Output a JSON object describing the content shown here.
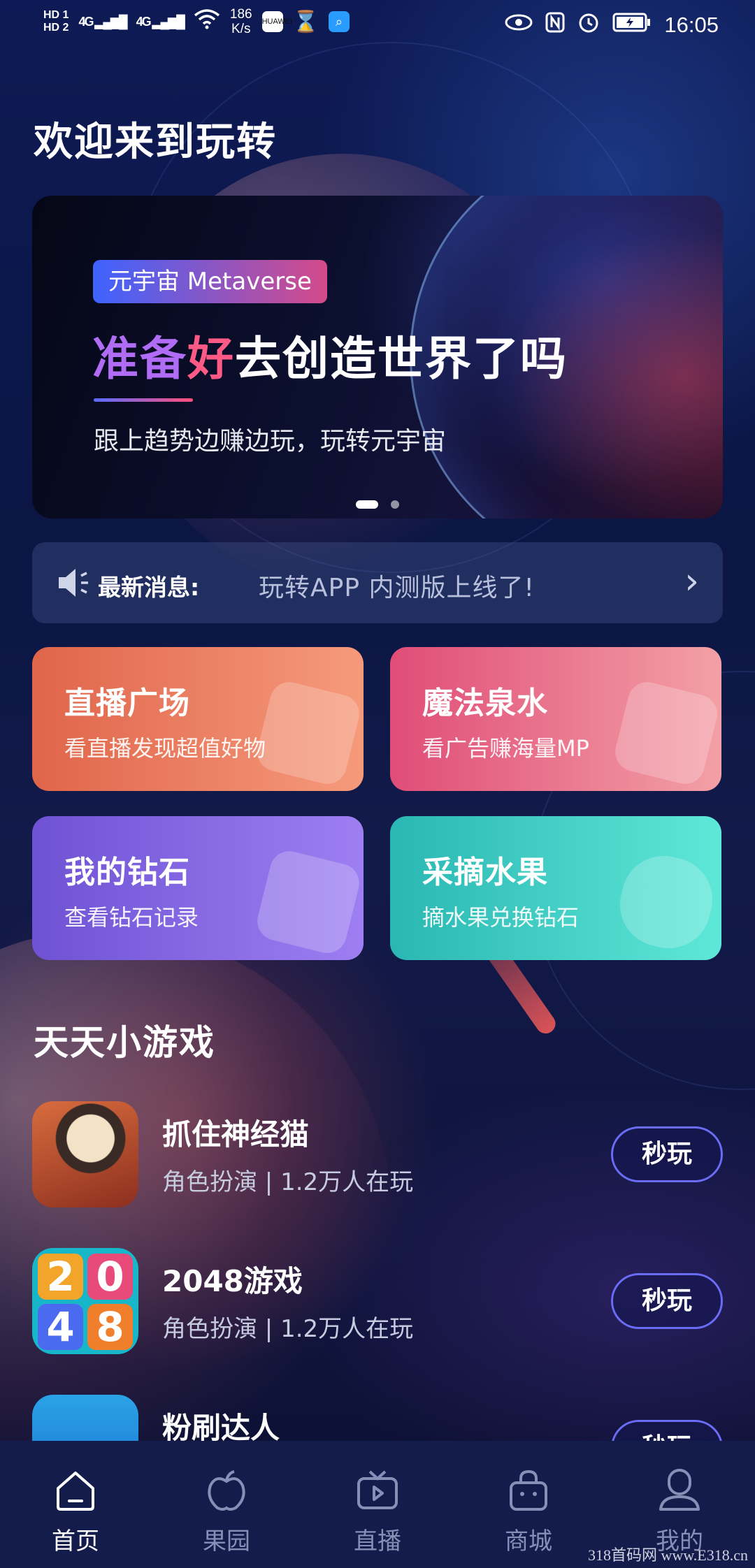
{
  "status_bar": {
    "hd1": "HD 1",
    "hd2": "HD 2",
    "signal1": "4G",
    "signal2": "4G",
    "speed_value": "186",
    "speed_unit": "K/s",
    "app_icon_1": "HUAWEI",
    "time": "16:05",
    "icons": [
      "hd-icon",
      "signal-icon",
      "wifi-icon",
      "huawei-app-icon",
      "hourglass-icon",
      "search-app-icon",
      "eye-icon",
      "nfc-icon",
      "alarm-icon",
      "battery-charging-icon"
    ]
  },
  "page": {
    "welcome_title": "欢迎来到玩转"
  },
  "banner": {
    "tag": "元宇宙 Metaverse",
    "title_part1": "准备",
    "title_part2": "好",
    "title_part3": "去创造世界了吗",
    "subtitle": "跟上趋势边赚边玩，玩转元宇宙",
    "active_slide": 0,
    "slide_count": 2
  },
  "news": {
    "label": "最新消息:",
    "text": "玩转APP  内测版上线了!",
    "chevron": "›"
  },
  "cards": [
    {
      "title": "直播广场",
      "subtitle": "看直播发现超值好物",
      "color": "#e0654a"
    },
    {
      "title": "魔法泉水",
      "subtitle": "看广告赚海量MP",
      "color": "#e04d77"
    },
    {
      "title": "我的钻石",
      "subtitle": "查看钻石记录",
      "color": "#6f52d4"
    },
    {
      "title": "采摘水果",
      "subtitle": "摘水果兑换钻石",
      "color": "#2ab7b3"
    }
  ],
  "games_section": {
    "title": "天天小游戏",
    "items": [
      {
        "name": "抓住神经猫",
        "meta": "角色扮演 | 1.2万人在玩",
        "button": "秒玩"
      },
      {
        "name": "2048游戏",
        "meta": "角色扮演 | 1.2万人在玩",
        "button": "秒玩",
        "tiles": [
          "2",
          "0",
          "4",
          "8"
        ]
      },
      {
        "name": "粉刷达人",
        "meta": "",
        "button": "秒玩"
      }
    ]
  },
  "bottom_nav": {
    "active_index": 0,
    "items": [
      {
        "label": "首页",
        "icon": "home-icon"
      },
      {
        "label": "果园",
        "icon": "apple-icon"
      },
      {
        "label": "直播",
        "icon": "tv-icon"
      },
      {
        "label": "商城",
        "icon": "shopping-bag-icon"
      },
      {
        "label": "我的",
        "icon": "user-icon"
      }
    ]
  },
  "watermark": "318首码网 www.E318.cn",
  "colors": {
    "accent": "#6a6cf5",
    "nav_bg": "#141c4c"
  }
}
